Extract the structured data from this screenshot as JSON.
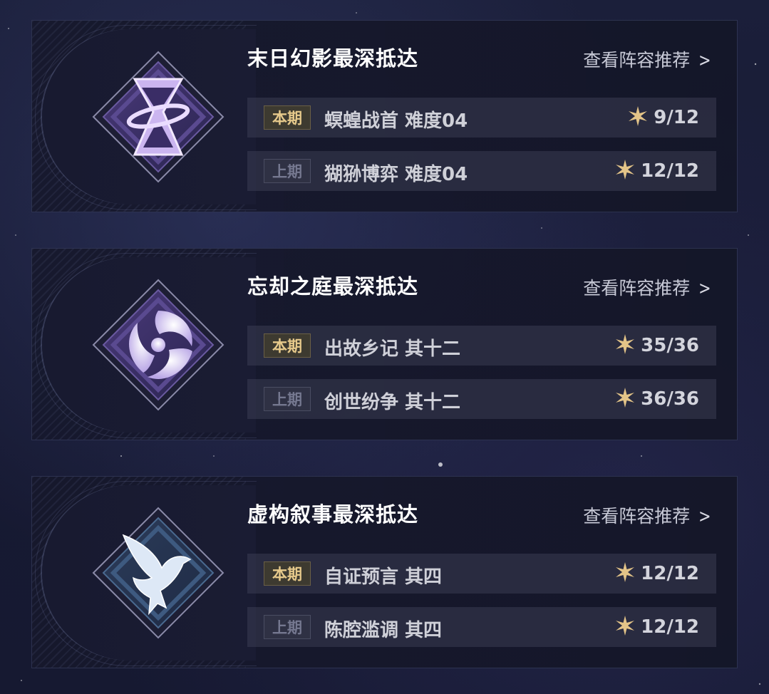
{
  "colors": {
    "background": "#171a33",
    "card": "#16182c",
    "tag_current_text": "#e6c98b",
    "tag_previous_text": "#757890",
    "star": "#e3c488"
  },
  "sections": [
    {
      "title": "末日幻影最深抵达",
      "icon": "hourglass-icon",
      "recommend_label": "查看阵容推荐",
      "rows": [
        {
          "tag": "本期",
          "name": "螟蝗战首 难度04",
          "score": "9/12"
        },
        {
          "tag": "上期",
          "name": "猢狲博弈 难度04",
          "score": "12/12"
        }
      ]
    },
    {
      "title": "忘却之庭最深抵达",
      "icon": "swirl-icon",
      "recommend_label": "查看阵容推荐",
      "rows": [
        {
          "tag": "本期",
          "name": "出故乡记 其十二",
          "score": "35/36"
        },
        {
          "tag": "上期",
          "name": "创世纷争 其十二",
          "score": "36/36"
        }
      ]
    },
    {
      "title": "虚构叙事最深抵达",
      "icon": "bird-icon",
      "recommend_label": "查看阵容推荐",
      "rows": [
        {
          "tag": "本期",
          "name": "自证预言 其四",
          "score": "12/12"
        },
        {
          "tag": "上期",
          "name": "陈腔滥调 其四",
          "score": "12/12"
        }
      ]
    }
  ]
}
